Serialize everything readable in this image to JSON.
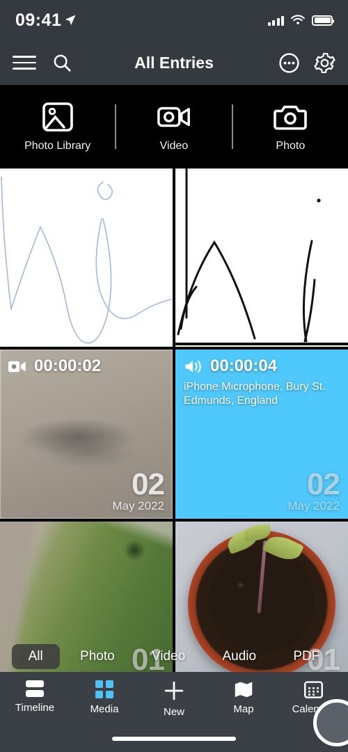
{
  "status_bar": {
    "time": "09:41",
    "location_icon": "location-arrow-icon",
    "signal_icon": "cellular-signal-icon",
    "wifi_icon": "wifi-icon",
    "battery_icon": "battery-full-icon"
  },
  "nav": {
    "menu_icon": "hamburger-menu-icon",
    "search_icon": "search-icon",
    "title": "All Entries",
    "more_icon": "more-options-icon",
    "settings_icon": "gear-icon"
  },
  "capture": {
    "items": [
      {
        "label": "Photo Library",
        "icon": "photo-library-icon"
      },
      {
        "label": "Video",
        "icon": "video-camera-icon"
      },
      {
        "label": "Photo",
        "icon": "camera-icon"
      }
    ]
  },
  "grid": {
    "rows": [
      {
        "cells": [
          {
            "type": "sketch",
            "name": "sketch-entry-blue",
            "ink": "#9fb9e0"
          },
          {
            "type": "sketch",
            "name": "sketch-entry-black",
            "ink": "#111111"
          }
        ]
      },
      {
        "cells": [
          {
            "type": "video",
            "name": "video-entry",
            "icon": "video-camera-filled-icon",
            "duration": "00:00:02",
            "subtitle": "",
            "date_day": "02",
            "date_month_year": "May 2022"
          },
          {
            "type": "audio",
            "name": "audio-entry",
            "icon": "speaker-icon",
            "duration": "00:00:04",
            "subtitle": "iPhone Microphone, Bury St. Edmunds, England",
            "date_day": "02",
            "date_month_year": "May 2022",
            "background_color": "#4fc8fb"
          }
        ]
      },
      {
        "cells": [
          {
            "type": "photo",
            "name": "photo-entry-garden",
            "icon": "",
            "duration": "",
            "subtitle": "",
            "date_day": "01",
            "date_month_year": ""
          },
          {
            "type": "photo",
            "name": "photo-entry-plant-pot",
            "icon": "",
            "duration": "",
            "subtitle": "",
            "date_day": "01",
            "date_month_year": ""
          }
        ]
      }
    ]
  },
  "filters": {
    "items": [
      {
        "label": "All",
        "active": true
      },
      {
        "label": "Photo",
        "active": false
      },
      {
        "label": "Video",
        "active": false
      },
      {
        "label": "Audio",
        "active": false
      },
      {
        "label": "PDF",
        "active": false
      }
    ]
  },
  "tabbar": {
    "items": [
      {
        "label": "Timeline",
        "icon": "timeline-rows-icon",
        "active": false
      },
      {
        "label": "Media",
        "icon": "media-grid-icon",
        "active": true
      },
      {
        "label": "New",
        "icon": "plus-icon",
        "active": false
      },
      {
        "label": "Map",
        "icon": "map-icon",
        "active": false
      },
      {
        "label": "Calendar",
        "icon": "calendar-icon",
        "active": false
      }
    ],
    "active_color": "#4fc3f7"
  }
}
